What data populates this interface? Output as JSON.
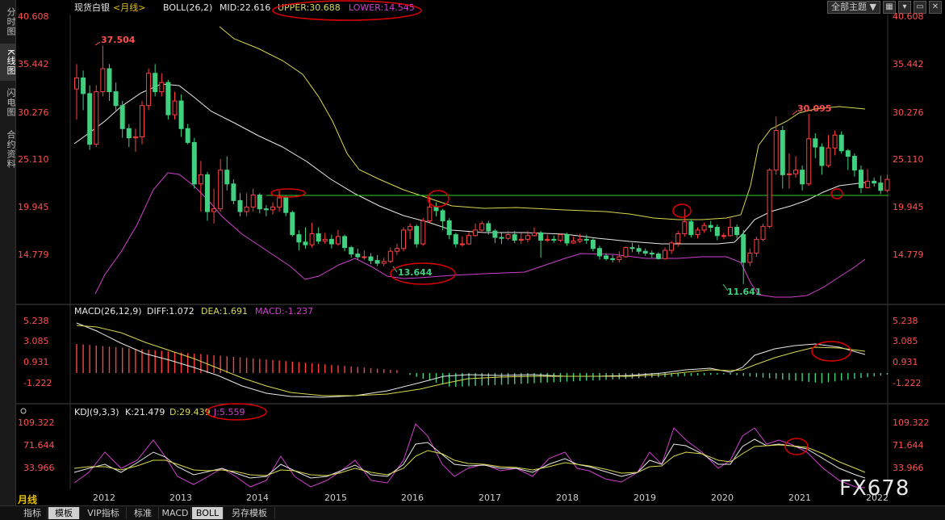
{
  "sidebar": {
    "tabs": [
      {
        "label": "分时图",
        "active": false
      },
      {
        "label": "K线图",
        "active": true
      },
      {
        "label": "闪电图",
        "active": false
      },
      {
        "label": "合约资料",
        "active": false
      }
    ]
  },
  "topbar": {
    "theme_label": "全部主题",
    "theme_arrow": "▼"
  },
  "main_panel": {
    "instrument": "现货白银",
    "period_tag": "<月线>",
    "indicator": "BOLL(26,2)",
    "mid_label": "MID:22.616",
    "upper_label": "UPPER:30.688",
    "lower_label": "LOWER:14.545",
    "y_ticks": [
      "40.608",
      "35.442",
      "30.276",
      "25.110",
      "19.945",
      "14.779"
    ],
    "annotations": [
      "37.504",
      "13.644",
      "11.641",
      "30.095"
    ]
  },
  "macd_panel": {
    "title": "MACD(26,12,9)",
    "diff_label": "DIFF:1.072",
    "dea_label": "DEA:1.691",
    "macd_label": "MACD:-1.237",
    "y_ticks": [
      "5.238",
      "3.085",
      "0.931",
      "-1.222"
    ]
  },
  "kdj_panel": {
    "title": "KDJ(9,3,3)",
    "k_label": "K:21.479",
    "d_label": "D:29.439",
    "j_label": "J:5.559",
    "y_ticks": [
      "109.322",
      "71.644",
      "33.966"
    ]
  },
  "x_axis": {
    "labels": [
      "2012",
      "2013",
      "2014",
      "2015",
      "2016",
      "2017",
      "2018",
      "2019",
      "2020",
      "2021",
      "2022"
    ]
  },
  "bottom_tabs": [
    {
      "label": "指标",
      "active": false
    },
    {
      "label": "模板",
      "active": true
    },
    {
      "label": "VIP指标",
      "active": false
    },
    {
      "label": "标准",
      "active": false
    },
    {
      "label": "MACD",
      "active": false
    },
    {
      "label": "BOLL",
      "active": true
    },
    {
      "label": "另存模板",
      "active": false
    }
  ],
  "period_selector": "月线",
  "watermark": "FX678",
  "colors": {
    "up": "#ff4040",
    "down": "#40d080",
    "mid": "#e8e8e8",
    "upper": "#d8d850",
    "lower": "#d040d0",
    "support_line": "#30d030",
    "highlight": "#e00000",
    "axis_text": "#ff5050"
  },
  "chart_data": {
    "type": "candlestick",
    "title": "现货白银<月线>",
    "x_start": "2011-09",
    "x_end": "2021-09",
    "ylim": [
      11.0,
      41.5
    ],
    "support_level": 21.3,
    "candles": [
      [
        32.8,
        34.0,
        35.5,
        29.5
      ],
      [
        34.0,
        32.3,
        34.8,
        30.5
      ],
      [
        32.3,
        26.8,
        33.2,
        26.2
      ],
      [
        26.8,
        32.5,
        33.2,
        26.5
      ],
      [
        32.5,
        35.0,
        37.5,
        32.0
      ],
      [
        35.0,
        32.5,
        35.5,
        31.5
      ],
      [
        32.5,
        31.0,
        33.5,
        30.5
      ],
      [
        31.0,
        28.5,
        31.5,
        27.5
      ],
      [
        28.5,
        27.5,
        29.0,
        26.5
      ],
      [
        27.5,
        27.6,
        28.5,
        26.0
      ],
      [
        27.6,
        31.0,
        31.5,
        26.8
      ],
      [
        31.0,
        34.5,
        35.0,
        30.5
      ],
      [
        34.5,
        32.5,
        35.5,
        32.0
      ],
      [
        32.5,
        33.5,
        34.5,
        32.0
      ],
      [
        33.5,
        30.0,
        33.8,
        29.5
      ],
      [
        30.0,
        31.5,
        32.5,
        29.5
      ],
      [
        31.5,
        28.5,
        32.2,
        27.6
      ],
      [
        28.5,
        27.0,
        29.0,
        26.8
      ],
      [
        27.0,
        22.5,
        27.5,
        22.0
      ],
      [
        22.5,
        23.5,
        25.0,
        19.5
      ],
      [
        23.5,
        19.5,
        23.8,
        18.5
      ],
      [
        19.5,
        19.8,
        22.0,
        18.2
      ],
      [
        19.8,
        24.0,
        25.2,
        19.5
      ],
      [
        24.0,
        22.5,
        25.5,
        21.8
      ],
      [
        22.5,
        20.7,
        23.0,
        20.3
      ],
      [
        20.7,
        19.5,
        21.5,
        19.0
      ],
      [
        19.5,
        20.0,
        21.5,
        19.0
      ],
      [
        20.0,
        21.3,
        22.0,
        19.5
      ],
      [
        21.3,
        19.8,
        21.5,
        19.3
      ],
      [
        19.8,
        19.7,
        20.2,
        19.0
      ],
      [
        19.7,
        20.0,
        20.5,
        19.2
      ],
      [
        20.0,
        21.0,
        21.8,
        19.5
      ],
      [
        21.0,
        19.4,
        21.2,
        19.0
      ],
      [
        19.4,
        17.0,
        19.6,
        16.8
      ],
      [
        17.0,
        16.2,
        17.5,
        15.3
      ],
      [
        16.2,
        15.9,
        17.8,
        15.5
      ],
      [
        15.9,
        17.1,
        18.3,
        15.6
      ],
      [
        17.1,
        16.3,
        17.8,
        16.0
      ],
      [
        16.3,
        16.5,
        17.2,
        16.0
      ],
      [
        16.5,
        16.0,
        17.0,
        15.5
      ],
      [
        16.0,
        16.8,
        17.5,
        15.8
      ],
      [
        16.8,
        15.6,
        17.0,
        15.2
      ],
      [
        15.6,
        14.9,
        15.8,
        14.5
      ],
      [
        14.9,
        14.6,
        15.5,
        14.3
      ],
      [
        14.6,
        14.6,
        15.3,
        14.3
      ],
      [
        14.6,
        14.2,
        15.0,
        13.8
      ],
      [
        14.2,
        13.9,
        14.8,
        13.6
      ],
      [
        13.9,
        14.1,
        14.5,
        13.6
      ],
      [
        14.1,
        15.2,
        15.6,
        13.9
      ],
      [
        15.2,
        15.5,
        16.0,
        14.8
      ],
      [
        15.5,
        17.5,
        17.8,
        15.2
      ],
      [
        17.5,
        17.9,
        18.2,
        16.5
      ],
      [
        17.9,
        16.0,
        18.1,
        15.6
      ],
      [
        16.0,
        18.5,
        18.8,
        15.8
      ],
      [
        18.5,
        20.0,
        21.1,
        18.3
      ],
      [
        20.0,
        19.6,
        20.5,
        19.0
      ],
      [
        19.6,
        18.5,
        19.8,
        17.5
      ],
      [
        18.5,
        17.0,
        18.8,
        16.5
      ],
      [
        17.0,
        16.0,
        17.2,
        15.6
      ],
      [
        16.0,
        16.0,
        16.8,
        15.7
      ],
      [
        16.0,
        16.9,
        17.3,
        15.9
      ],
      [
        16.9,
        17.5,
        18.2,
        16.8
      ],
      [
        17.5,
        18.2,
        18.5,
        17.2
      ],
      [
        18.2,
        17.4,
        18.5,
        17.0
      ],
      [
        17.4,
        16.7,
        17.6,
        16.1
      ],
      [
        16.7,
        16.6,
        17.2,
        16.0
      ],
      [
        16.6,
        17.0,
        17.4,
        16.4
      ],
      [
        17.0,
        16.4,
        17.4,
        16.1
      ],
      [
        16.4,
        16.5,
        17.2,
        16.0
      ],
      [
        16.5,
        16.9,
        17.4,
        16.2
      ],
      [
        16.9,
        17.2,
        17.8,
        16.8
      ],
      [
        17.2,
        16.4,
        17.4,
        14.5
      ],
      [
        16.4,
        16.5,
        17.0,
        16.2
      ],
      [
        16.5,
        16.4,
        16.9,
        16.1
      ],
      [
        16.4,
        17.0,
        17.1,
        16.2
      ],
      [
        17.0,
        16.1,
        17.2,
        15.8
      ],
      [
        16.1,
        16.3,
        16.8,
        16.0
      ],
      [
        16.3,
        16.5,
        17.1,
        16.1
      ],
      [
        16.5,
        16.4,
        17.0,
        16.0
      ],
      [
        16.4,
        15.5,
        16.6,
        15.2
      ],
      [
        15.5,
        14.7,
        15.8,
        14.3
      ],
      [
        14.7,
        14.4,
        15.0,
        14.2
      ],
      [
        14.4,
        14.3,
        14.8,
        14.0
      ],
      [
        14.3,
        14.6,
        15.2,
        14.0
      ],
      [
        14.6,
        15.6,
        15.7,
        14.5
      ],
      [
        15.6,
        15.5,
        16.1,
        15.1
      ],
      [
        15.5,
        15.2,
        15.9,
        14.9
      ],
      [
        15.2,
        15.0,
        15.5,
        14.7
      ],
      [
        15.0,
        14.9,
        15.3,
        14.5
      ],
      [
        14.9,
        14.4,
        15.1,
        14.3
      ],
      [
        14.4,
        15.3,
        15.6,
        14.3
      ],
      [
        15.3,
        16.1,
        16.3,
        14.9
      ],
      [
        16.1,
        17.1,
        17.4,
        15.7
      ],
      [
        17.1,
        18.4,
        19.8,
        16.8
      ],
      [
        18.4,
        17.0,
        18.7,
        16.7
      ],
      [
        17.0,
        17.5,
        17.8,
        16.6
      ],
      [
        17.5,
        18.0,
        18.3,
        17.2
      ],
      [
        18.0,
        17.8,
        18.5,
        17.3
      ],
      [
        17.8,
        16.9,
        18.1,
        16.4
      ],
      [
        16.9,
        16.9,
        17.2,
        16.5
      ],
      [
        16.9,
        17.8,
        18.8,
        16.8
      ],
      [
        17.8,
        17.0,
        18.1,
        16.6
      ],
      [
        17.0,
        14.0,
        17.5,
        11.64
      ],
      [
        14.0,
        15.0,
        15.5,
        13.6
      ],
      [
        15.0,
        16.5,
        16.8,
        14.6
      ],
      [
        16.5,
        17.9,
        18.2,
        16.3
      ],
      [
        17.9,
        24.0,
        24.2,
        17.7
      ],
      [
        24.0,
        28.3,
        29.8,
        23.5
      ],
      [
        28.3,
        23.5,
        28.8,
        22.0
      ],
      [
        23.5,
        23.6,
        25.8,
        22.0
      ],
      [
        23.6,
        24.0,
        25.5,
        23.2
      ],
      [
        24.0,
        22.5,
        24.5,
        21.8
      ],
      [
        22.5,
        27.4,
        30.095,
        22.3
      ],
      [
        27.4,
        26.5,
        28.0,
        25.3
      ],
      [
        26.5,
        24.5,
        26.9,
        23.5
      ],
      [
        24.5,
        26.4,
        27.8,
        24.3
      ],
      [
        26.4,
        27.8,
        28.3,
        25.6
      ],
      [
        27.8,
        26.1,
        28.2,
        25.8
      ],
      [
        26.1,
        25.5,
        26.3,
        24.0
      ],
      [
        25.5,
        24.0,
        25.8,
        23.3
      ],
      [
        24.0,
        22.1,
        24.5,
        21.5
      ],
      [
        22.1,
        22.8,
        24.1,
        22.0
      ],
      [
        22.8,
        22.6,
        23.2,
        22.2
      ],
      [
        22.6,
        21.8,
        23.4,
        21.4
      ],
      [
        21.8,
        23.0,
        23.5,
        21.6
      ]
    ]
  }
}
